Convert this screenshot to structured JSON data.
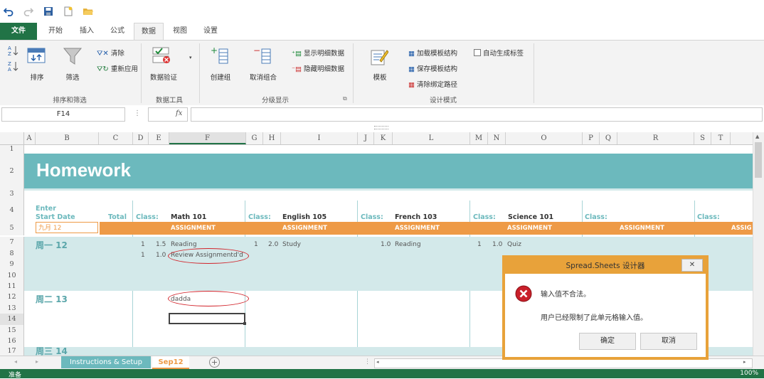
{
  "qat": {
    "icons": [
      "undo-icon",
      "redo-icon",
      "save-icon",
      "new-icon",
      "open-icon"
    ]
  },
  "tabs": [
    "文件",
    "开始",
    "插入",
    "公式",
    "数据",
    "视图",
    "设置"
  ],
  "ribbon": {
    "sort_filter": {
      "sort": "排序",
      "filter": "筛选",
      "clear": "清除",
      "reapply": "重新应用",
      "group": "排序和筛选"
    },
    "data_tools": {
      "validate": "数据验证",
      "group": "数据工具"
    },
    "outline": {
      "create_group": "创建组",
      "ungroup": "取消组合",
      "show_detail": "显示明细数据",
      "hide_detail": "隐藏明细数据",
      "group": "分级显示"
    },
    "design": {
      "template": "模板",
      "load": "加载模板结构",
      "save": "保存模板结构",
      "clear_binding": "清除绑定路径",
      "auto_label": "自动生成标签",
      "group": "设计模式"
    }
  },
  "formula_bar": {
    "name_box": "F14",
    "fx": "fx",
    "value": ""
  },
  "columns": [
    "A",
    "B",
    "C",
    "D",
    "E",
    "F",
    "G",
    "H",
    "I",
    "J",
    "K",
    "L",
    "M",
    "N",
    "O",
    "P",
    "Q",
    "R",
    "S",
    "T"
  ],
  "rows": [
    "1",
    "2",
    "3",
    "4",
    "5",
    "7",
    "8",
    "9",
    "10",
    "11",
    "12",
    "13",
    "14",
    "15",
    "16",
    "17"
  ],
  "sheet": {
    "title": "Homework",
    "enter_label": "Enter",
    "start_date_label": "Start Date",
    "total_label": "Total",
    "start_date_value": "九月 12",
    "classes": [
      {
        "label": "Class:",
        "name": "Math 101",
        "assign": "ASSIGNMENT"
      },
      {
        "label": "Class:",
        "name": "English 105",
        "assign": "ASSIGNMENT"
      },
      {
        "label": "Class:",
        "name": "French 103",
        "assign": "ASSIGNMENT"
      },
      {
        "label": "Class:",
        "name": "Science 101",
        "assign": "ASSIGNMENT"
      },
      {
        "label": "Class:",
        "name": "",
        "assign": "ASSIGNMENT"
      },
      {
        "label": "Class:",
        "name": "",
        "assign": "ASSIG"
      }
    ],
    "day1": "周一 12",
    "day2": "周二 13",
    "day3": "周三 14",
    "math_rows": [
      {
        "num": "1",
        "hours": "1.5",
        "task": "Reading"
      },
      {
        "num": "1",
        "hours": "1.0",
        "task": "Review Assignmentd'd"
      }
    ],
    "english_row": {
      "num": "1",
      "hours": "2.0",
      "task": "Study"
    },
    "french_row": {
      "hours": "1.0",
      "task": "Reading"
    },
    "science_row": {
      "num": "1",
      "hours": "1.0",
      "task": "Quiz"
    },
    "day2_task": "dadda"
  },
  "sheet_tabs": [
    "Instructions & Setup",
    "Sep12"
  ],
  "status": {
    "left": "准备",
    "zoom": "100%"
  },
  "dialog": {
    "title": "Spread.Sheets 设计器",
    "line1": "输入值不合法。",
    "line2": "用户已经限制了此单元格输入值。",
    "ok": "确定",
    "cancel": "取消"
  },
  "colors": {
    "teal": "#6cb9bd",
    "light_teal": "#d3e9ea",
    "orange": "#ee9a46",
    "green": "#217346",
    "dialog_border": "#e8a23a",
    "error_red": "#c9202a"
  }
}
